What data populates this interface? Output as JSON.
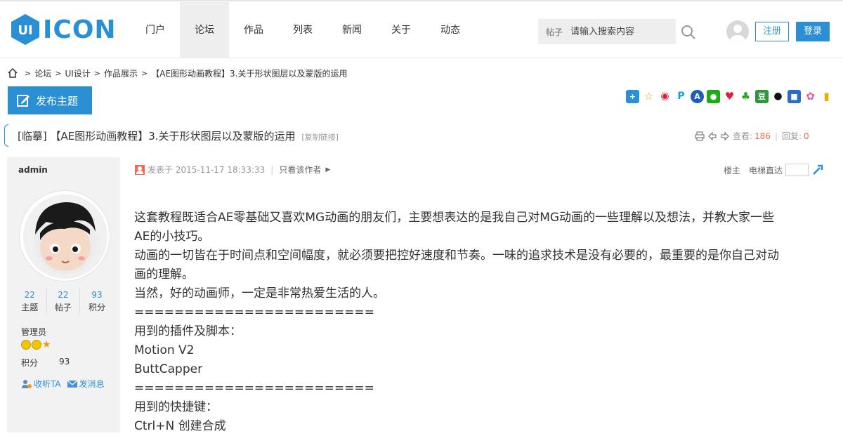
{
  "header": {
    "logo_text": "ICON",
    "logo_mark": "UI",
    "nav": [
      "门户",
      "论坛",
      "作品",
      "列表",
      "新闻",
      "关于",
      "动态"
    ],
    "nav_active_index": 1,
    "search_type": "帖子",
    "search_placeholder": "请输入搜索内容",
    "register_label": "注册",
    "login_label": "登录"
  },
  "breadcrumb": [
    "论坛",
    "UI设计",
    "作品展示",
    "【AE图形动画教程】3.关于形状图层以及蒙版的运用"
  ],
  "post_button_label": "发布主题",
  "share_icons": [
    "plus-icon",
    "star-icon",
    "weibo-icon",
    "qq-space-icon",
    "renren-icon",
    "wechat-icon",
    "heart-icon",
    "clover-icon",
    "douban-icon",
    "qq-icon",
    "kaixin-icon",
    "flower-icon",
    "bookmark-icon"
  ],
  "thread": {
    "title": "[临摹] 【AE图形动画教程】3.关于形状图层以及蒙版的运用",
    "copy_link": "[复制链接]",
    "views_label": "查看:",
    "views": "186",
    "replies_label": "回复:",
    "replies": "0"
  },
  "author": {
    "name": "admin",
    "stats": [
      {
        "value": "22",
        "label": "主题"
      },
      {
        "value": "22",
        "label": "帖子"
      },
      {
        "value": "93",
        "label": "积分"
      }
    ],
    "rank": "管理员",
    "credits_label": "积分",
    "credits_value": "93",
    "follow_label": "收听TA",
    "message_label": "发消息"
  },
  "post": {
    "posted_at": "发表于 2015-11-17 18:33:33",
    "only_author": "只看该作者",
    "floor_label": "楼主",
    "jump_label": "电梯直达",
    "body": [
      "这套教程既适合AE零基础又喜欢MG动画的朋友们，主要想表达的是我自己对MG动画的一些理解以及想法，并教大家一些",
      "AE的小技巧。",
      "动画的一切皆在于时间点和空间幅度，就必须要把控好速度和节奏。一味的追求技术是没有必要的，最重要的是你自己对动",
      "画的理解。",
      "当然，好的动画师，一定是非常热爱生活的人。",
      "========================",
      "用到的插件及脚本：",
      "Motion V2",
      "ButtCapper",
      "========================",
      "用到的快捷键：",
      "Ctrl+N 创建合成"
    ]
  },
  "colors": {
    "accent": "#2b8fd6",
    "highlight": "#f26c4f",
    "sidebar_bg": "#f2f2f2"
  }
}
